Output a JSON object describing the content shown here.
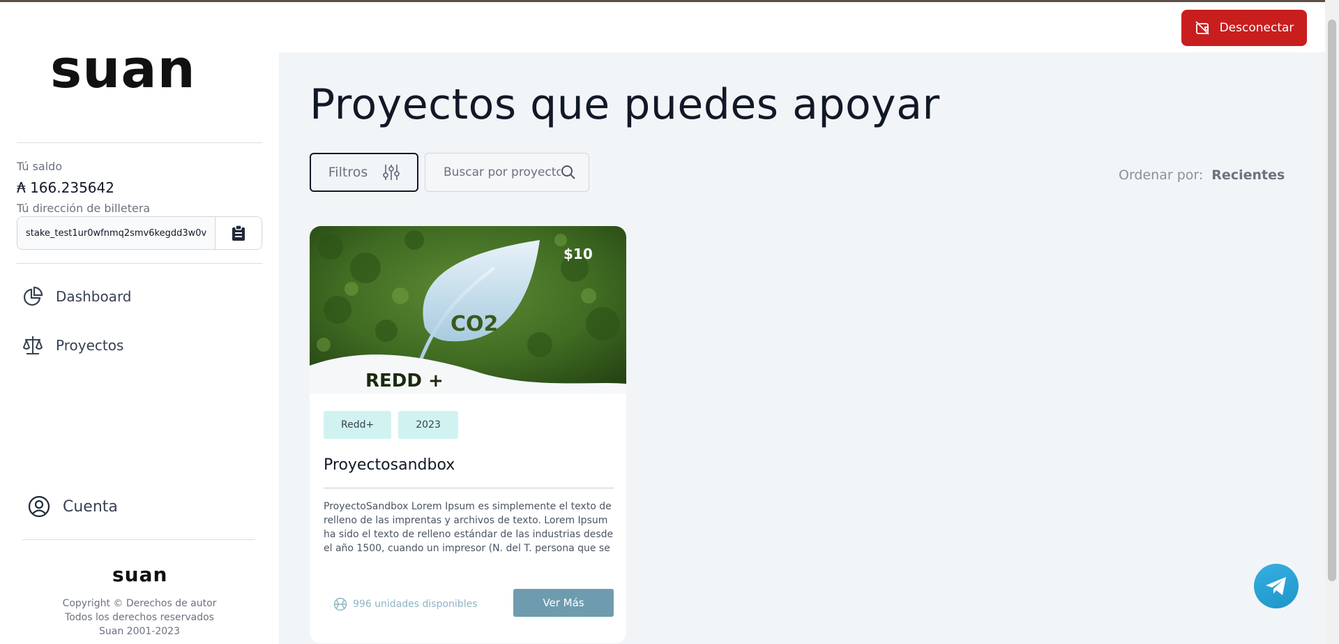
{
  "brand": {
    "logo_text": "suan",
    "footer_logo_text": "suan"
  },
  "header": {
    "disconnect_label": "Desconectar"
  },
  "sidebar": {
    "balance_label": "Tú saldo",
    "balance_value": "₳ 166.235642",
    "wallet_label": "Tú dirección de billetera",
    "wallet_address": "stake_test1ur0wfnmq2smv6kegdd3w0v",
    "nav": [
      {
        "label": "Dashboard",
        "icon": "pie-chart-icon"
      },
      {
        "label": "Proyectos",
        "icon": "scale-icon"
      }
    ],
    "account_label": "Cuenta",
    "footer": {
      "line1": "Copyright © Derechos de autor",
      "line2": "Todos los derechos reservados",
      "line3": "Suan 2001-2023"
    }
  },
  "main": {
    "title": "Proyectos que puedes apoyar",
    "filters_label": "Filtros",
    "search_placeholder": "Buscar por proyectos",
    "sort_label": "Ordenar por:",
    "sort_value": "Recientes"
  },
  "projects": [
    {
      "price": "$10",
      "image_text_co2": "CO2",
      "image_text_program": "REDD +",
      "tags": [
        "Redd+",
        "2023"
      ],
      "title": "Proyectosandbox",
      "description": "ProyectoSandbox Lorem Ipsum es simplemente el texto de relleno de las imprentas y archivos de texto. Lorem Ipsum ha sido el texto de relleno estándar de las industrias desde el año 1500, cuando un impresor (N. del T. persona que se",
      "units": "996 unidades disponibles",
      "cta": "Ver Más"
    }
  ],
  "colors": {
    "danger": "#c81e1e",
    "accent": "#6e9cae",
    "tag_bg": "#d0f3f1",
    "main_bg": "#f2f5f7"
  }
}
